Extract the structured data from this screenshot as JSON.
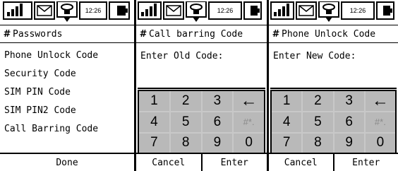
{
  "status": {
    "time": "12:26"
  },
  "screens": [
    {
      "title": "Passwords",
      "items": [
        "Phone Unlock Code",
        "Security Code",
        "SIM PIN Code",
        "SIM PIN2 Code",
        "Call Barring Code"
      ],
      "softkeys": [
        "Done"
      ]
    },
    {
      "title": "Call barring Code",
      "prompt": "Enter Old Code:",
      "keys": [
        "1",
        "2",
        "3",
        "←",
        "4",
        "5",
        "6",
        "#*.",
        "7",
        "8",
        "9",
        "0"
      ],
      "softkeys": [
        "Cancel",
        "Enter"
      ]
    },
    {
      "title": "Phone Unlock Code",
      "prompt": "Enter New Code:",
      "keys": [
        "1",
        "2",
        "3",
        "←",
        "4",
        "5",
        "6",
        "#*.",
        "7",
        "8",
        "9",
        "0"
      ],
      "softkeys": [
        "Cancel",
        "Enter"
      ]
    }
  ]
}
